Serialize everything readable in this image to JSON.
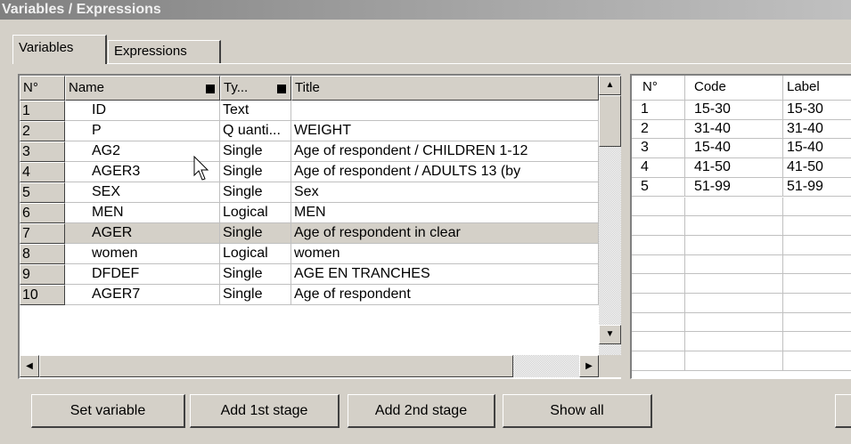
{
  "window": {
    "title": "Variables / Expressions"
  },
  "tabs": [
    {
      "label": "Variables",
      "active": true
    },
    {
      "label": "Expressions",
      "active": false
    }
  ],
  "variables_grid": {
    "columns": [
      "N°",
      "Name",
      "Ty...",
      "Title"
    ],
    "rows": [
      {
        "n": "1",
        "name": "ID",
        "type": "Text",
        "title": ""
      },
      {
        "n": "2",
        "name": "P",
        "type": "Q uanti...",
        "title": "WEIGHT"
      },
      {
        "n": "3",
        "name": "AG2",
        "type": "Single",
        "title": "Age of respondent / CHILDREN 1-12"
      },
      {
        "n": "4",
        "name": "AGER3",
        "type": "Single",
        "title": "Age of respondent / ADULTS 13 (by"
      },
      {
        "n": "5",
        "name": "SEX",
        "type": "Single",
        "title": "Sex"
      },
      {
        "n": "6",
        "name": "MEN",
        "type": "Logical",
        "title": "MEN"
      },
      {
        "n": "7",
        "name": "AGER",
        "type": "Single",
        "title": "Age of respondent  in clear"
      },
      {
        "n": "8",
        "name": "women",
        "type": "Logical",
        "title": "women"
      },
      {
        "n": "9",
        "name": "DFDEF",
        "type": "Single",
        "title": "AGE EN TRANCHES"
      },
      {
        "n": "10",
        "name": "AGER7",
        "type": "Single",
        "title": "Age of respondent"
      }
    ],
    "selected_row": 7
  },
  "codes_grid": {
    "columns": [
      "N°",
      "Code",
      "Label"
    ],
    "rows": [
      {
        "n": "1",
        "code": "15-30",
        "label": "15-30"
      },
      {
        "n": "2",
        "code": "31-40",
        "label": "31-40"
      },
      {
        "n": "3",
        "code": "15-40",
        "label": "15-40"
      },
      {
        "n": "4",
        "code": "41-50",
        "label": "41-50"
      },
      {
        "n": "5",
        "code": "51-99",
        "label": "51-99"
      }
    ]
  },
  "buttons": {
    "set_variable": "Set variable",
    "add_1st_stage": "Add 1st stage",
    "add_2nd_stage": "Add 2nd stage",
    "show_all": "Show all"
  },
  "icons": {
    "scroll_up": "▲",
    "scroll_down": "▼",
    "scroll_left": "◀",
    "scroll_right": "▶"
  }
}
